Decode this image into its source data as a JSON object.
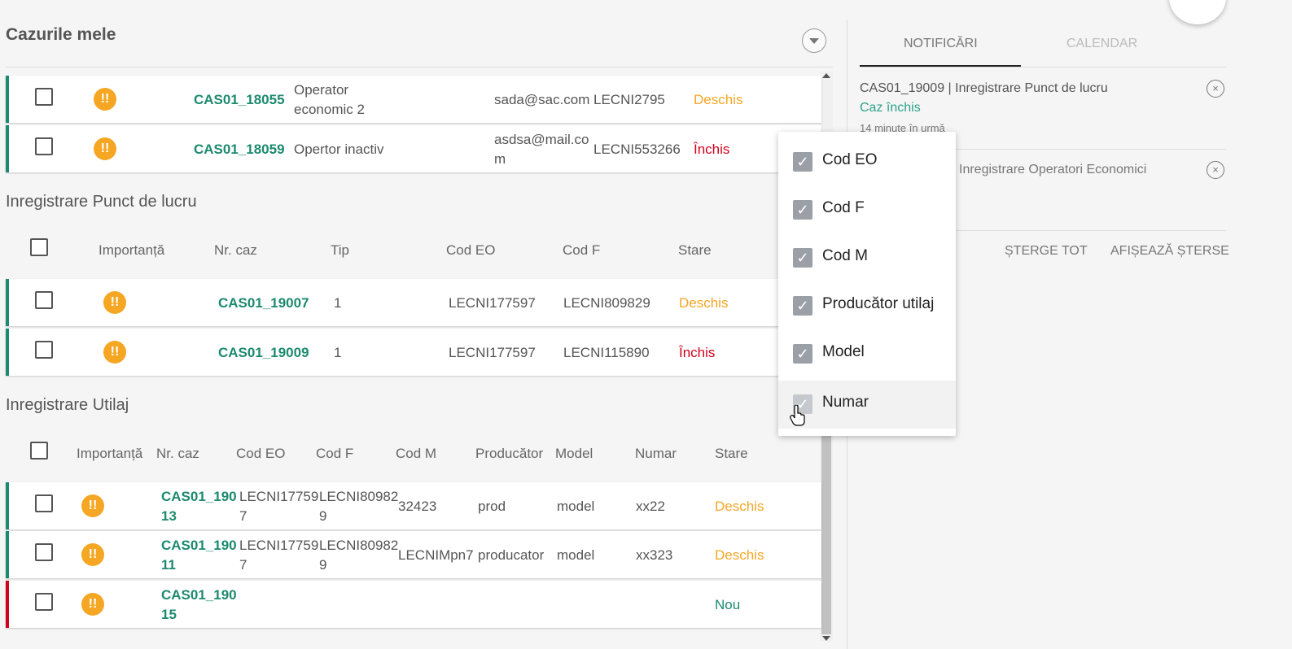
{
  "header": {
    "title": "Cazurile mele"
  },
  "section1": {
    "rows": [
      {
        "case": "CAS01_18055",
        "name": "Operator economic 2",
        "email": "sada@sac.com",
        "code": "LECNI2795",
        "status": "Deschis",
        "status_type": "open"
      },
      {
        "case": "CAS01_18059",
        "name": "Opertor inactiv",
        "email": "asdsa@mail.com",
        "code": "LECNI553266",
        "status": "Închis",
        "status_type": "closed"
      }
    ]
  },
  "section2": {
    "title": "Inregistrare Punct de lucru",
    "headers": {
      "importance": "Importanță",
      "case": "Nr. caz",
      "type": "Tip",
      "eo": "Cod EO",
      "f": "Cod F",
      "status": "Stare"
    },
    "rows": [
      {
        "case": "CAS01_19007",
        "type": "1",
        "eo": "LECNI177597",
        "f": "LECNI809829",
        "status": "Deschis"
      },
      {
        "case": "CAS01_19009",
        "type": "1",
        "eo": "LECNI177597",
        "f": "LECNI115890",
        "status": "Închis"
      }
    ]
  },
  "section3": {
    "title": "Inregistrare Utilaj",
    "headers": {
      "importance": "Importanță",
      "case": "Nr. caz",
      "eo": "Cod EO",
      "f": "Cod F",
      "m": "Cod M",
      "producer": "Producător",
      "model": "Model",
      "number": "Numar",
      "status": "Stare"
    },
    "rows": [
      {
        "case_a": "CAS01_190",
        "case_b": "13",
        "eo_a": "LECNI17759",
        "eo_b": "7",
        "f_a": "LECNI80982",
        "f_b": "9",
        "m": "32423",
        "producer": "prod",
        "model": "model",
        "number": "xx22",
        "status": "Deschis"
      },
      {
        "case_a": "CAS01_190",
        "case_b": "11",
        "eo_a": "LECNI17759",
        "eo_b": "7",
        "f_a": "LECNI80982",
        "f_b": "9",
        "m": "LECNIMpn7",
        "producer": "producator",
        "model": "model",
        "number": "xx323",
        "status": "Deschis"
      },
      {
        "case_a": "CAS01_190",
        "case_b": "15",
        "eo_a": "",
        "eo_b": "",
        "f_a": "",
        "f_b": "",
        "m": "",
        "producer": "",
        "model": "",
        "number": "",
        "status": "Nou"
      }
    ]
  },
  "column_menu": {
    "items": [
      {
        "label": "Cod EO",
        "checked": true
      },
      {
        "label": "Cod F",
        "checked": true
      },
      {
        "label": "Cod M",
        "checked": true
      },
      {
        "label": "Producător utilaj",
        "checked": true
      },
      {
        "label": "Model",
        "checked": true
      },
      {
        "label": "Numar",
        "checked": true
      }
    ]
  },
  "side_panel": {
    "tabs": {
      "notifications": "NOTIFICĂRI",
      "calendar": "CALENDAR"
    },
    "notifications": [
      {
        "title": "CAS01_19009 | Inregistrare Punct de lucru",
        "status": "Caz închis",
        "time": "14 minute în urmă"
      },
      {
        "title": "Inregistrare Operatori Economici"
      }
    ],
    "actions": {
      "clear_all": "ȘTERGE TOT",
      "show_deleted": "AFIȘEAZĂ ȘTERSE"
    }
  },
  "colors": {
    "accent": "#1c8a6e",
    "open": "#f5a623",
    "closed": "#d0021b"
  }
}
